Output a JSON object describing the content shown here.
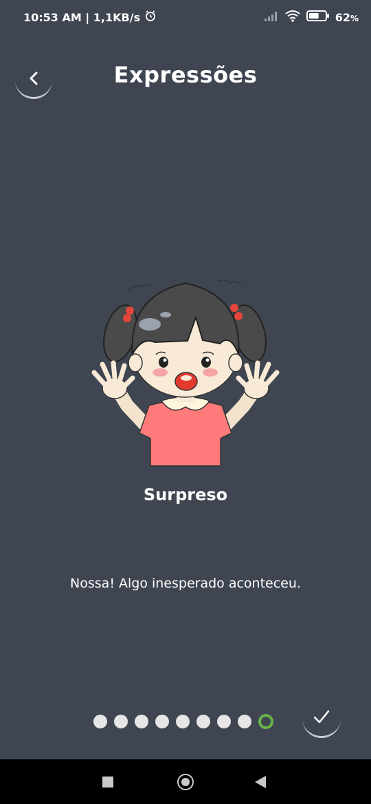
{
  "status": {
    "time_speed": "10:53 AM | 1,1KB/s",
    "battery": "62",
    "battery_unit": "%",
    "battery_level": 0.62
  },
  "header": {
    "title": "Expressões"
  },
  "expression": {
    "name": "Surpreso",
    "description": "Nossa! Algo inesperado aconteceu."
  },
  "pager": {
    "total": 9,
    "current": 9
  },
  "colors": {
    "background": "#3f4652",
    "active_dot": "#6ab34a",
    "dot": "#e6e6e6"
  }
}
